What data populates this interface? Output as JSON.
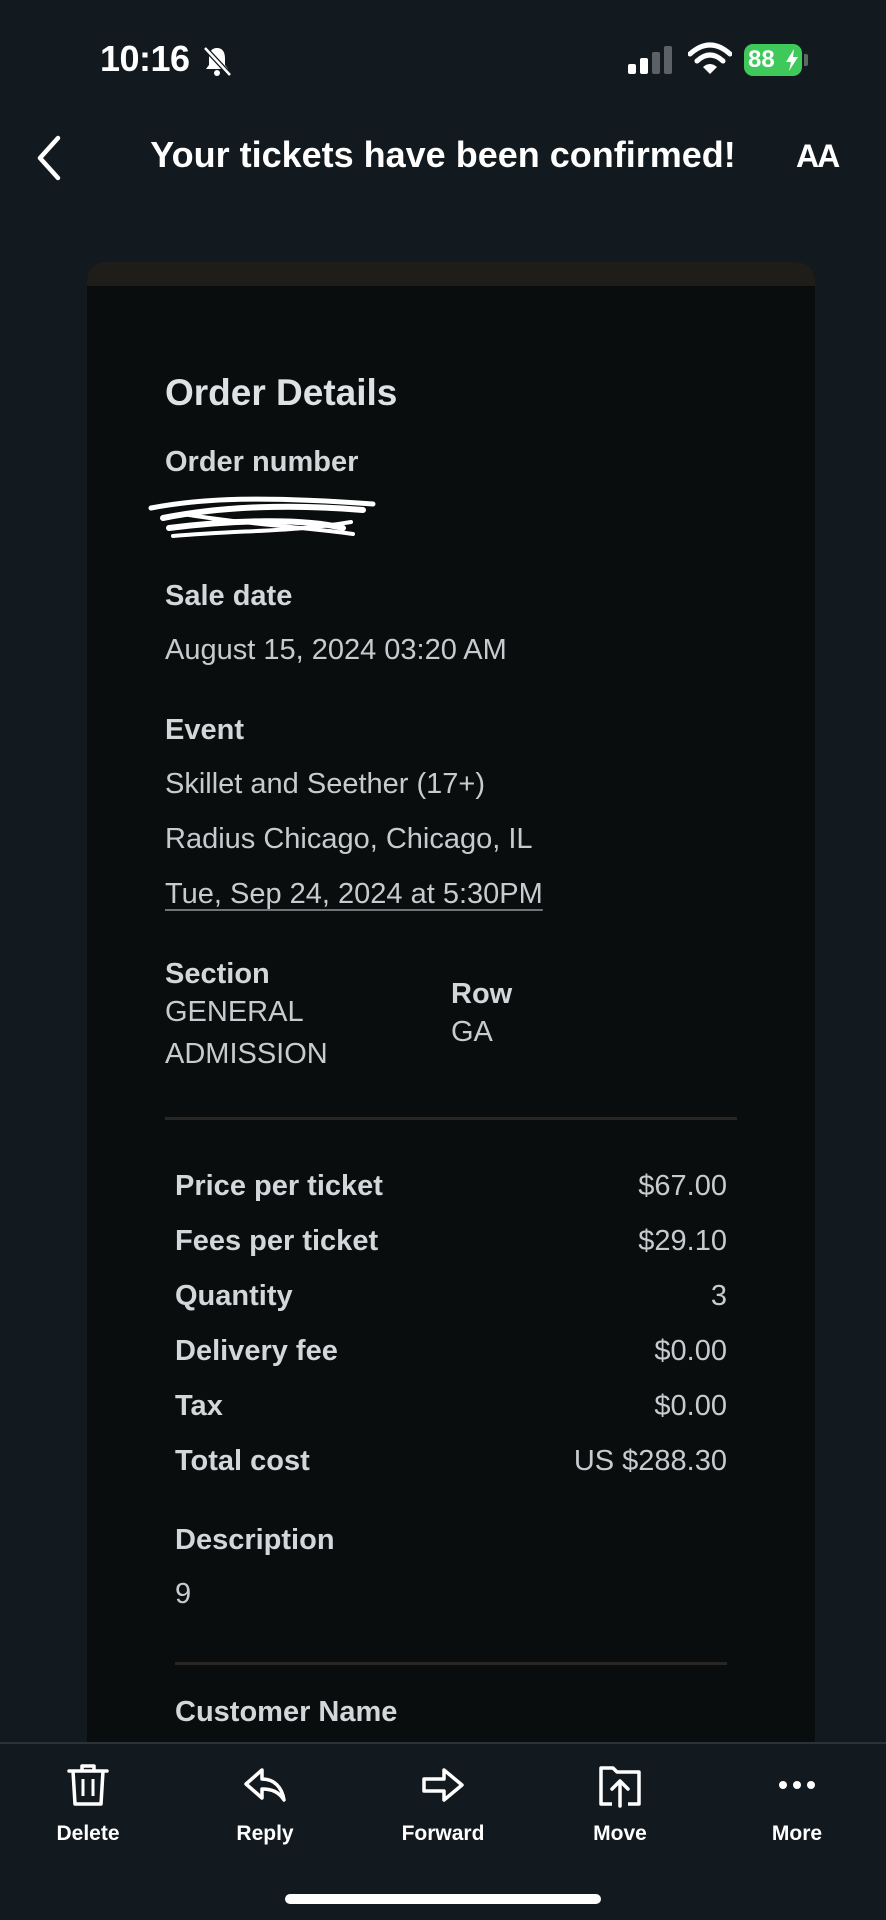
{
  "status_bar": {
    "time": "10:16",
    "battery": "88"
  },
  "header": {
    "title": "Your tickets have been confirmed!",
    "text_size_icon": "AA"
  },
  "order": {
    "heading": "Order Details",
    "order_number_label": "Order number",
    "sale_date_label": "Sale date",
    "sale_date": "August 15, 2024 03:20 AM",
    "event_label": "Event",
    "event_name": "Skillet and Seether (17+)",
    "venue": "Radius Chicago, Chicago, IL",
    "event_datetime": "Tue, Sep 24, 2024 at 5:30PM",
    "section_label": "Section",
    "section_line1": "GENERAL",
    "section_line2": "ADMISSION",
    "row_label": "Row",
    "row_value": "GA"
  },
  "pricing": [
    {
      "label": "Price per ticket",
      "value": "$67.00"
    },
    {
      "label": "Fees per ticket",
      "value": "$29.10"
    },
    {
      "label": "Quantity",
      "value": "3"
    },
    {
      "label": "Delivery fee",
      "value": "$0.00"
    },
    {
      "label": "Tax",
      "value": "$0.00"
    },
    {
      "label": "Total cost",
      "value": "US $288.30"
    }
  ],
  "description": {
    "label": "Description",
    "value": "9"
  },
  "customer": {
    "label": "Customer Name"
  },
  "toolbar": {
    "delete": "Delete",
    "reply": "Reply",
    "forward": "Forward",
    "move": "Move",
    "more": "More"
  },
  "colors": {
    "background": "#131a1f",
    "card": "#0a0d0e",
    "battery": "#3ec95a"
  }
}
